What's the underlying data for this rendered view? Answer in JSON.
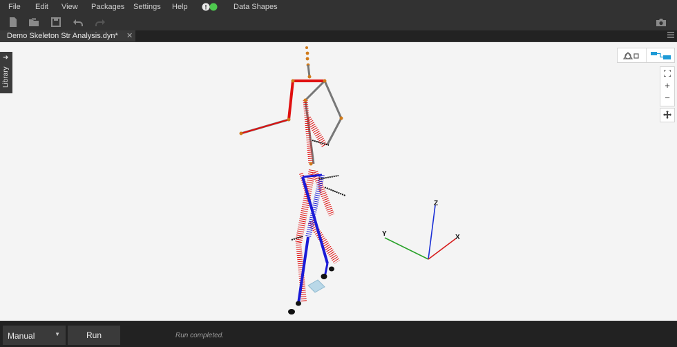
{
  "menu": {
    "file": "File",
    "edit": "Edit",
    "view": "View",
    "packages": "Packages",
    "settings": "Settings",
    "help": "Help",
    "data_shapes": "Data Shapes"
  },
  "tab": {
    "title": "Demo Skeleton Str Analysis.dyn*",
    "close": "✕"
  },
  "library": {
    "label": "Library"
  },
  "axes": {
    "x": "X",
    "y": "Y",
    "z": "Z"
  },
  "bottom": {
    "run_mode": "Manual",
    "run_button": "Run",
    "status": "Run completed."
  },
  "colors": {
    "accent": "#1e9ad6",
    "status_green": "#4ec94e",
    "lattice_red": "#e01010",
    "lattice_blue": "#1b1bd6"
  }
}
